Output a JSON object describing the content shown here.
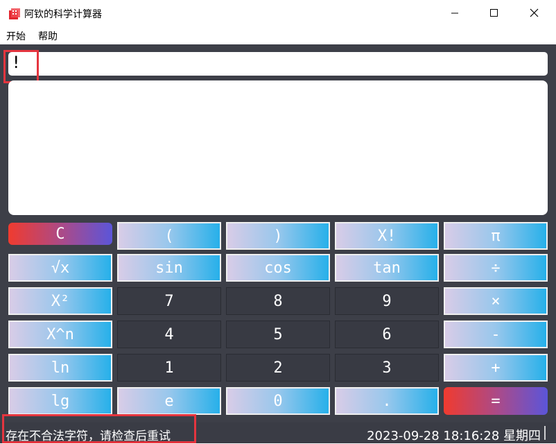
{
  "window": {
    "title": "阿钦的科学计算器",
    "controls": {
      "minimize": "–",
      "maximize": "☐",
      "close": "✕"
    }
  },
  "menu": [
    {
      "label": "开始"
    },
    {
      "label": "帮助"
    }
  ],
  "expression": {
    "value": "!"
  },
  "result": {
    "value": ""
  },
  "keypad": [
    {
      "label": "C",
      "style": "red"
    },
    {
      "label": "(",
      "style": "grad"
    },
    {
      "label": ")",
      "style": "grad"
    },
    {
      "label": "X!",
      "style": "grad"
    },
    {
      "label": "π",
      "style": "grad"
    },
    {
      "label": "√x",
      "style": "grad"
    },
    {
      "label": "sin",
      "style": "grad"
    },
    {
      "label": "cos",
      "style": "grad"
    },
    {
      "label": "tan",
      "style": "grad"
    },
    {
      "label": "÷",
      "style": "grad"
    },
    {
      "label": "X²",
      "style": "grad"
    },
    {
      "label": "7",
      "style": "dark"
    },
    {
      "label": "8",
      "style": "dark"
    },
    {
      "label": "9",
      "style": "dark"
    },
    {
      "label": "×",
      "style": "grad"
    },
    {
      "label": "X^n",
      "style": "grad"
    },
    {
      "label": "4",
      "style": "dark"
    },
    {
      "label": "5",
      "style": "dark"
    },
    {
      "label": "6",
      "style": "dark"
    },
    {
      "label": "-",
      "style": "grad"
    },
    {
      "label": "ln",
      "style": "grad"
    },
    {
      "label": "1",
      "style": "dark"
    },
    {
      "label": "2",
      "style": "dark"
    },
    {
      "label": "3",
      "style": "dark"
    },
    {
      "label": "+",
      "style": "grad"
    },
    {
      "label": "lg",
      "style": "grad"
    },
    {
      "label": "e",
      "style": "grad"
    },
    {
      "label": "0",
      "style": "grad"
    },
    {
      "label": ".",
      "style": "grad"
    },
    {
      "label": "=",
      "style": "red"
    }
  ],
  "status": {
    "message": "存在不合法字符，请检查后重试",
    "datetime": "2023-09-28 18:16:28 星期四"
  },
  "colors": {
    "background": "#3d3f48",
    "highlight": "#e5353f",
    "accent_blue": "#27b0ea",
    "accent_red": "#f03b2f"
  }
}
